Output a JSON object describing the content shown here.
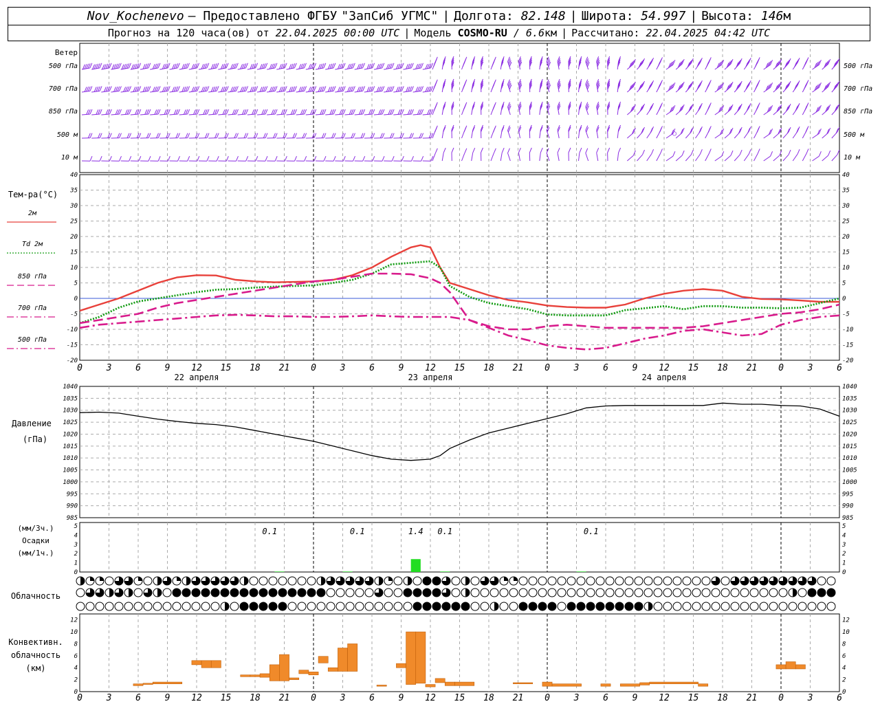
{
  "header": {
    "station": "Nov_Kochenevo",
    "provider_prefix": "– Предоставлено ФГБУ",
    "provider_name": "\"ЗапСиб УГМС\"",
    "longitude_label": "Долгота:",
    "longitude": "82.148",
    "latitude_label": "Широта:",
    "latitude": "54.997",
    "altitude_label": "Высота:",
    "altitude": "146",
    "altitude_unit": "м",
    "forecast_label": "Прогноз на 120 часа(ов) от",
    "forecast_start": "22.04.2025 00:00 UTC",
    "model_label": "Модель",
    "model_name": "COSMO-RU",
    "model_res": "/ 6.6",
    "model_res_unit": "км",
    "computed_label": "Рассчитано:",
    "computed_time": "22.04.2025 04:42 UTC"
  },
  "colors": {
    "t2m": "#e8403a",
    "td2m": "#139c13",
    "t850": "#d81b8c",
    "t700": "#d81b8c",
    "t500": "#d81b8c",
    "wind": "#8a2be2",
    "pressure": "#000000",
    "precip_bar": "#22dd22",
    "convective_bar": "#f08a2a",
    "grid": "#aaaaaa",
    "zero_line": "#3a5ad8"
  },
  "time_axis": {
    "hour_ticks": [
      "0",
      "3",
      "6",
      "9",
      "12",
      "15",
      "18",
      "21",
      "0",
      "3",
      "6",
      "9",
      "12",
      "15",
      "18",
      "21",
      "0",
      "3",
      "6",
      "9",
      "12",
      "15",
      "18",
      "21",
      "0",
      "3",
      "6"
    ],
    "day_labels": [
      {
        "label": "22 апреля",
        "hour": 12
      },
      {
        "label": "23 апреля",
        "hour": 36
      },
      {
        "label": "24 апреля",
        "hour": 60
      }
    ],
    "day_boundaries": [
      24,
      48,
      72
    ],
    "hours_shown": 78
  },
  "wind_panel": {
    "title": "Ветер",
    "levels": [
      "500 гПа",
      "700 гПа",
      "850 гПа",
      "500 м",
      "10 м"
    ],
    "calm_symbol": "○"
  },
  "temp_panel": {
    "title": "Тем-ра(°С)",
    "legend": [
      {
        "key": "t2m",
        "label": "2м",
        "style": "solid"
      },
      {
        "key": "td2m",
        "label": "Td 2м",
        "style": "dotted"
      },
      {
        "key": "t850",
        "label": "850 гПа",
        "style": "dash"
      },
      {
        "key": "t700",
        "label": "700 гПа",
        "style": "dashdot"
      },
      {
        "key": "t500",
        "label": "500 гПа",
        "style": "dashdot"
      }
    ],
    "ticks": [
      "40",
      "35",
      "30",
      "25",
      "20",
      "15",
      "10",
      "5",
      "0",
      "-5",
      "-10",
      "-15",
      "-20"
    ]
  },
  "pressure_panel": {
    "title": "Давление",
    "unit": "(гПа)",
    "ticks": [
      "1040",
      "1035",
      "1030",
      "1025",
      "1020",
      "1015",
      "1010",
      "1005",
      "1000",
      "995",
      "990",
      "985"
    ]
  },
  "precip_panel": {
    "unit_3h": "(мм/3ч.)",
    "title": "Осадки",
    "unit_1h": "(мм/1ч.)",
    "ticks": [
      "5",
      "4",
      "3",
      "2",
      "1",
      "0"
    ],
    "annotations": [
      {
        "hour": 19.5,
        "text": "0.1"
      },
      {
        "hour": 28.5,
        "text": "0.1"
      },
      {
        "hour": 34.5,
        "text": "1.4"
      },
      {
        "hour": 37.5,
        "text": "0.1"
      },
      {
        "hour": 52.5,
        "text": "0.1"
      }
    ]
  },
  "cloud_panel": {
    "title": "Облачность"
  },
  "conv_panel": {
    "title_1": "Конвективн.",
    "title_2": "облачность",
    "unit": "(км)",
    "ticks": [
      "12",
      "10",
      "8",
      "6",
      "4",
      "2",
      "0"
    ]
  },
  "chart_data": [
    {
      "type": "line",
      "title": "Тем-ра(°С)",
      "x_unit": "hours from 22.04.2025 00:00 UTC",
      "ylim": [
        -20,
        40
      ],
      "grid": true,
      "series": [
        {
          "name": "2м",
          "x": [
            0,
            2,
            4,
            6,
            8,
            10,
            12,
            14,
            16,
            18,
            20,
            22,
            24,
            26,
            28,
            30,
            32,
            34,
            35,
            36,
            37,
            38,
            40,
            42,
            44,
            46,
            48,
            50,
            52,
            54,
            56,
            58,
            60,
            62,
            64,
            66,
            68,
            70,
            72,
            74,
            76,
            78
          ],
          "y": [
            -4,
            -2,
            0,
            2.5,
            5,
            6.8,
            7.5,
            7.4,
            6,
            5.5,
            5.2,
            5.3,
            5.5,
            6,
            7.5,
            10,
            13.5,
            16.5,
            17.2,
            16.5,
            10,
            5,
            3,
            1,
            -0.5,
            -1.3,
            -2.3,
            -2.8,
            -3,
            -3,
            -2,
            0,
            1.5,
            2.5,
            3,
            2.5,
            0.5,
            -0.2,
            -0.3,
            -0.7,
            -1.1,
            -1.1
          ]
        },
        {
          "name": "Td 2м",
          "x": [
            0,
            2,
            4,
            6,
            8,
            10,
            12,
            14,
            16,
            18,
            20,
            22,
            24,
            26,
            28,
            30,
            32,
            34,
            36,
            37,
            38,
            40,
            42,
            44,
            46,
            48,
            50,
            52,
            54,
            56,
            58,
            60,
            62,
            64,
            66,
            68,
            70,
            72,
            74,
            76,
            78
          ],
          "y": [
            -8,
            -6,
            -3,
            -1,
            0,
            1,
            2,
            2.8,
            3,
            3.5,
            3.8,
            4,
            4.2,
            5,
            6,
            8,
            11,
            11.5,
            12,
            10,
            4,
            0.5,
            -1.5,
            -2.5,
            -3.5,
            -5.2,
            -5.5,
            -5.5,
            -5.5,
            -3.8,
            -3.2,
            -2.5,
            -3.5,
            -2.5,
            -2.5,
            -3,
            -3,
            -3.2,
            -3,
            -1.5,
            0
          ]
        },
        {
          "name": "850 гПа",
          "x": [
            0,
            2,
            4,
            6,
            8,
            10,
            12,
            14,
            16,
            18,
            20,
            22,
            24,
            26,
            28,
            30,
            32,
            34,
            36,
            37,
            38,
            40,
            42,
            44,
            46,
            48,
            50,
            52,
            54,
            56,
            58,
            60,
            62,
            64,
            66,
            68,
            70,
            72,
            74,
            76,
            78
          ],
          "y": [
            -8,
            -7,
            -6,
            -5,
            -3,
            -1.5,
            -0.5,
            0.5,
            1.5,
            2.5,
            3.5,
            4.5,
            5.5,
            6,
            7,
            8,
            8,
            7.8,
            6.5,
            5,
            2,
            -7,
            -9,
            -10,
            -10,
            -9,
            -8.5,
            -9,
            -9.5,
            -9.5,
            -9.5,
            -9.5,
            -9.5,
            -9,
            -8,
            -7,
            -6,
            -5,
            -4.5,
            -3.5,
            -2
          ]
        },
        {
          "name": "700 гПа",
          "x": [
            0,
            2,
            4,
            6,
            8,
            10,
            12,
            14,
            16,
            18,
            20,
            22,
            24,
            26,
            28,
            30,
            32,
            34,
            36,
            38,
            40,
            42,
            44,
            46,
            48,
            50,
            52,
            54,
            56,
            58,
            60,
            62,
            64,
            66,
            68,
            70,
            72,
            74,
            76,
            78
          ],
          "y": [
            -9.5,
            -8.5,
            -8,
            -7.5,
            -7,
            -6.5,
            -6,
            -5.5,
            -5.3,
            -5.5,
            -5.8,
            -5.8,
            -6,
            -6,
            -5.8,
            -5.5,
            -5.8,
            -6,
            -6,
            -6,
            -7,
            -9.5,
            -12,
            -13.5,
            -15.2,
            -16,
            -16.5,
            -16,
            -14.5,
            -13,
            -12,
            -10.5,
            -10,
            -11,
            -12,
            -11.5,
            -8.5,
            -7,
            -6,
            -5.5
          ]
        },
        {
          "name": "500 гПа",
          "x": [],
          "y": []
        }
      ]
    },
    {
      "type": "line",
      "title": "Давление",
      "x_unit": "hours from 22.04.2025 00:00 UTC",
      "ylim": [
        985,
        1040
      ],
      "grid": true,
      "series": [
        {
          "x": [
            0,
            2,
            4,
            6,
            8,
            10,
            12,
            14,
            16,
            18,
            20,
            22,
            24,
            26,
            28,
            30,
            32,
            34,
            36,
            37,
            38,
            40,
            42,
            44,
            46,
            48,
            50,
            52,
            54,
            56,
            58,
            60,
            62,
            64,
            66,
            68,
            70,
            72,
            74,
            76,
            78
          ],
          "y": [
            1029,
            1029.2,
            1028.8,
            1027.5,
            1026.3,
            1025.3,
            1024.5,
            1024,
            1023,
            1021.5,
            1020,
            1018.5,
            1017,
            1015,
            1013,
            1011,
            1009.5,
            1009,
            1009.5,
            1011,
            1014,
            1017.5,
            1020.5,
            1022.5,
            1024.5,
            1026.5,
            1028.5,
            1031,
            1031.8,
            1032,
            1032,
            1032,
            1032,
            1032,
            1033,
            1032.5,
            1032.5,
            1032,
            1031.8,
            1030.5,
            1027.5
          ]
        }
      ]
    },
    {
      "type": "bar",
      "title": "Осадки",
      "x_unit": "hours from 22.04.2025 00:00 UTC",
      "ylim": [
        0,
        5
      ],
      "bars": [
        {
          "x0": 20,
          "x1": 21,
          "value": 0.05
        },
        {
          "x0": 27,
          "x1": 28,
          "value": 0.05
        },
        {
          "x0": 34,
          "x1": 35,
          "value": 1.4
        },
        {
          "x0": 37,
          "x1": 38,
          "value": 0.05
        },
        {
          "x0": 51,
          "x1": 52,
          "value": 0.05
        }
      ]
    },
    {
      "type": "table",
      "title": "Облачность",
      "legend": "F=full, B=mostly, H=half, Q=quarter, E=clear",
      "rows": [
        "HQQEBBQEHBQHBBBBBHEEEEEEEHBBBBBHQEHEFFBEHEBBQQEEEEEEEEEEEEEEEEEEEEBEBBBBBBBBBEEEEEEEEE",
        "EBBHBHEBHEFFFFFFFFFFFFFFFFEEEEEBEEFFFFBEHEEEEEEEEEEEEEEEEEEEEEEEEEEEEEEEEEHEFFFFFFFFFBBF",
        "EEEEEEEEEEEEEEEHEFFFFFEEEEEEEEEEEEEFFFFFFEEHEEFFFFEFFFFFFFFHEEEEEEEEEEEEEEEEEEEEEEEEEEEE"
      ]
    },
    {
      "type": "bar",
      "title": "Конвективн. облачность",
      "x_unit": "hours from 22.04.2025 00:00 UTC",
      "ylim": [
        0,
        13
      ],
      "bars": [
        {
          "x0": 5.5,
          "x1": 6.5,
          "base": 1.0,
          "top": 1.3
        },
        {
          "x0": 6.5,
          "x1": 7.5,
          "base": 1.2,
          "top": 1.4
        },
        {
          "x0": 7.5,
          "x1": 10.5,
          "base": 1.3,
          "top": 1.6
        },
        {
          "x0": 11.5,
          "x1": 12.5,
          "base": 4.5,
          "top": 5.2
        },
        {
          "x0": 12.5,
          "x1": 13.5,
          "base": 4.0,
          "top": 5.2
        },
        {
          "x0": 13.5,
          "x1": 14.5,
          "base": 4.0,
          "top": 5.2
        },
        {
          "x0": 16.5,
          "x1": 17.5,
          "base": 2.5,
          "top": 2.8
        },
        {
          "x0": 17.5,
          "x1": 18.5,
          "base": 2.5,
          "top": 2.8
        },
        {
          "x0": 18.5,
          "x1": 19.5,
          "base": 2.4,
          "top": 3.0
        },
        {
          "x0": 19.5,
          "x1": 20.5,
          "base": 1.8,
          "top": 4.5
        },
        {
          "x0": 20.5,
          "x1": 21.5,
          "base": 1.8,
          "top": 6.2
        },
        {
          "x0": 21.5,
          "x1": 22.5,
          "base": 2.0,
          "top": 2.3
        },
        {
          "x0": 22.5,
          "x1": 23.5,
          "base": 3.0,
          "top": 3.6
        },
        {
          "x0": 23.5,
          "x1": 24.5,
          "base": 2.8,
          "top": 3.3
        },
        {
          "x0": 24.5,
          "x1": 25.5,
          "base": 4.8,
          "top": 5.9
        },
        {
          "x0": 25.5,
          "x1": 26.5,
          "base": 3.4,
          "top": 4.0
        },
        {
          "x0": 26.5,
          "x1": 27.5,
          "base": 3.4,
          "top": 7.3
        },
        {
          "x0": 27.5,
          "x1": 28.5,
          "base": 3.4,
          "top": 8.0
        },
        {
          "x0": 30.5,
          "x1": 31.5,
          "base": 0.9,
          "top": 1.1
        },
        {
          "x0": 32.5,
          "x1": 33.5,
          "base": 4.0,
          "top": 4.7
        },
        {
          "x0": 33.5,
          "x1": 34.5,
          "base": 1.2,
          "top": 10.0
        },
        {
          "x0": 34.5,
          "x1": 35.5,
          "base": 1.4,
          "top": 10.0
        },
        {
          "x0": 35.5,
          "x1": 36.5,
          "base": 0.8,
          "top": 1.2
        },
        {
          "x0": 36.5,
          "x1": 37.5,
          "base": 1.5,
          "top": 2.2
        },
        {
          "x0": 37.5,
          "x1": 38.5,
          "base": 1.0,
          "top": 1.6
        },
        {
          "x0": 38.5,
          "x1": 40.5,
          "base": 1.0,
          "top": 1.6
        },
        {
          "x0": 44.5,
          "x1": 46.5,
          "base": 1.3,
          "top": 1.5
        },
        {
          "x0": 47.5,
          "x1": 48.5,
          "base": 0.9,
          "top": 1.6
        },
        {
          "x0": 48.5,
          "x1": 51.5,
          "base": 0.9,
          "top": 1.3
        },
        {
          "x0": 53.5,
          "x1": 54.5,
          "base": 0.9,
          "top": 1.3
        },
        {
          "x0": 55.5,
          "x1": 57.5,
          "base": 0.9,
          "top": 1.3
        },
        {
          "x0": 57.5,
          "x1": 58.5,
          "base": 1.1,
          "top": 1.5
        },
        {
          "x0": 58.5,
          "x1": 63.5,
          "base": 1.3,
          "top": 1.6
        },
        {
          "x0": 63.5,
          "x1": 64.5,
          "base": 0.9,
          "top": 1.3
        },
        {
          "x0": 71.5,
          "x1": 72.5,
          "base": 3.8,
          "top": 4.5
        },
        {
          "x0": 72.5,
          "x1": 73.5,
          "base": 3.8,
          "top": 5.0
        },
        {
          "x0": 73.5,
          "x1": 74.5,
          "base": 3.8,
          "top": 4.5
        }
      ]
    }
  ],
  "wind_data": {
    "rows": [
      {
        "key": "500 гПа",
        "values": "5555554444444444444444444444444444444444444444444444444444444444444444444444444"
      },
      {
        "key": "700 гПа",
        "values": "4444444444444444444444444444444444444444444444444444444444444444444444444444444"
      },
      {
        "key": "850 гПа",
        "values": "3333333333333333333333333333333333333333333333333333333333333333333333333333333"
      },
      {
        "key": "500 м",
        "values": "2222222222222222222222222222222222222222222222222222222222222222222222222222222"
      },
      {
        "key": "10 м",
        "values": "1111111111111111111111111111111111111111111111111111111111111111111111111111111"
      }
    ]
  }
}
